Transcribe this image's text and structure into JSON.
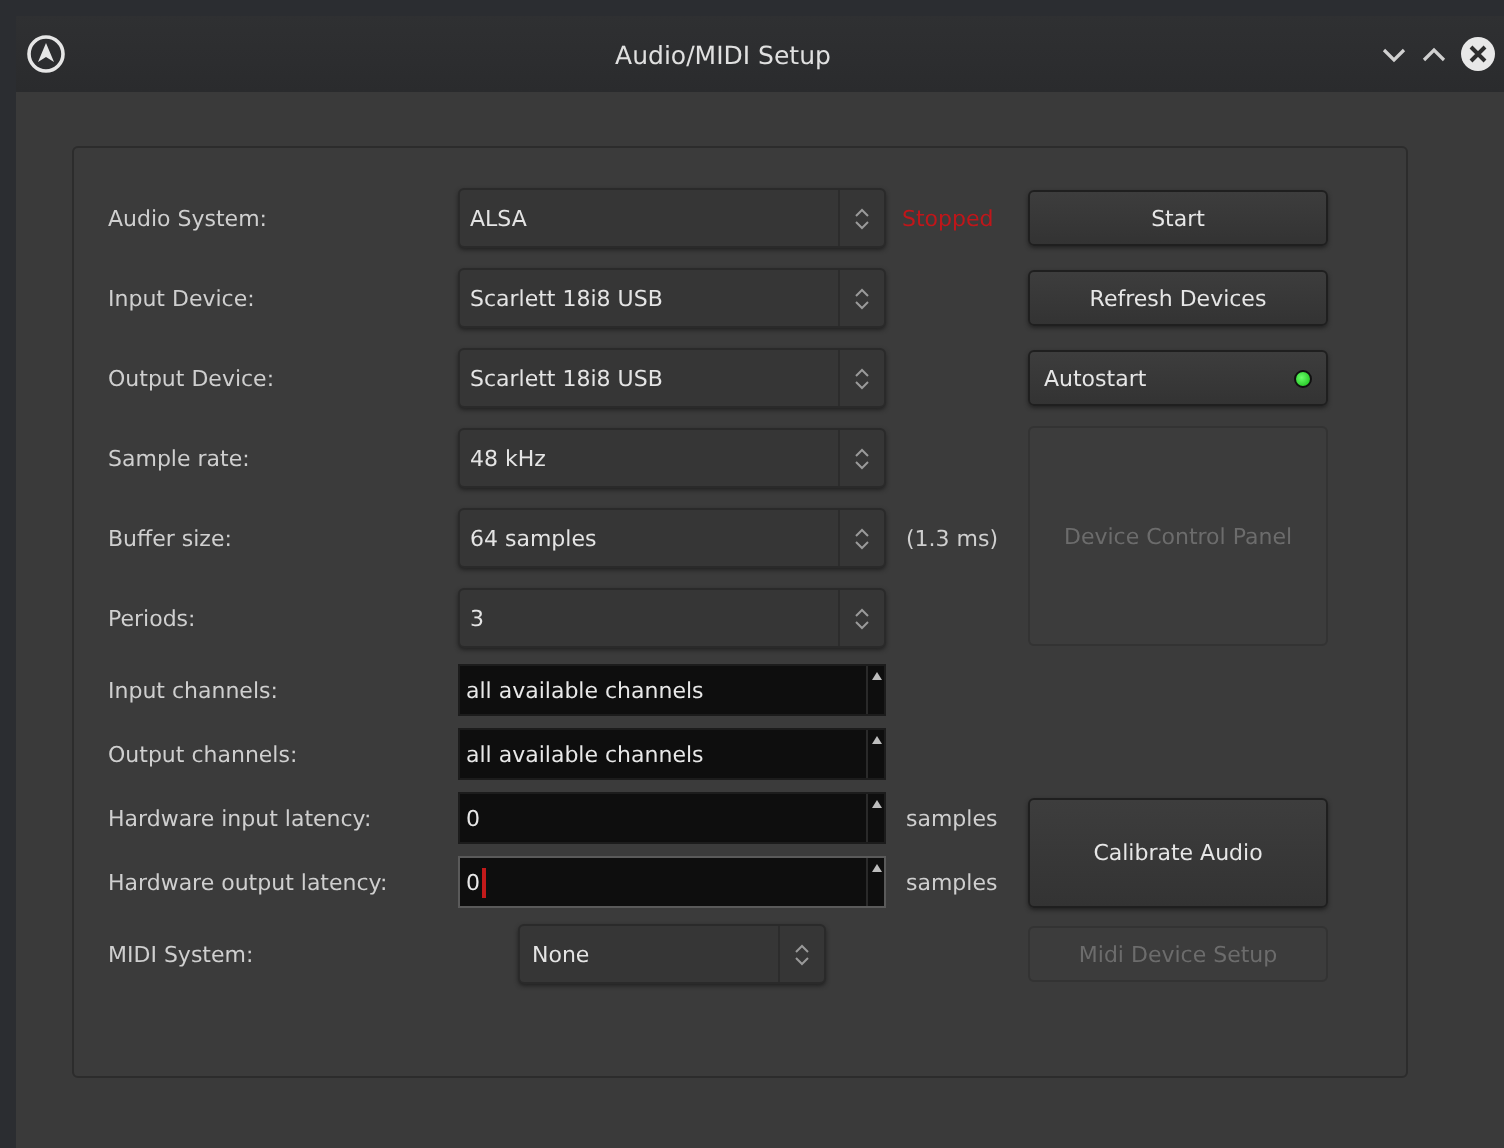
{
  "window": {
    "title": "Audio/MIDI Setup"
  },
  "rows": [
    {
      "kind": "combo",
      "label": "Audio System:",
      "value": "ALSA",
      "note": {
        "text": "Stopped",
        "kind": "status"
      }
    },
    {
      "kind": "combo",
      "label": "Input Device:",
      "value": "Scarlett 18i8 USB"
    },
    {
      "kind": "combo",
      "label": "Output Device:",
      "value": "Scarlett 18i8 USB"
    },
    {
      "kind": "combo",
      "label": "Sample rate:",
      "value": "48 kHz"
    },
    {
      "kind": "combo",
      "label": "Buffer size:",
      "value": "64 samples",
      "note": {
        "text": "(1.3 ms)",
        "kind": "plain"
      }
    },
    {
      "kind": "combo",
      "label": "Periods:",
      "value": "3"
    },
    {
      "kind": "spin",
      "label": "Input channels:",
      "value": "all available channels",
      "focused": false
    },
    {
      "kind": "spin",
      "label": "Output channels:",
      "value": "all available channels",
      "focused": false
    },
    {
      "kind": "spin",
      "label": "Hardware input latency:",
      "value": "0",
      "focused": false,
      "note": {
        "text": "samples",
        "kind": "plain"
      }
    },
    {
      "kind": "spin",
      "label": "Hardware output latency:",
      "value": "0",
      "focused": true,
      "note": {
        "text": "samples",
        "kind": "plain"
      }
    },
    {
      "kind": "combo",
      "label": "MIDI System:",
      "value": "None",
      "narrow": true
    }
  ],
  "buttons": [
    {
      "kind": "push",
      "label": "Start",
      "disabled": false
    },
    {
      "kind": "push",
      "label": "Refresh Devices",
      "disabled": false
    },
    {
      "kind": "toggle",
      "label": "Autostart",
      "disabled": false,
      "on": true
    },
    {
      "kind": "push",
      "label": "Device Control Panel",
      "disabled": true
    },
    {
      "kind": "push",
      "label": "Calibrate Audio",
      "disabled": false
    },
    {
      "kind": "push",
      "label": "Midi Device Setup",
      "disabled": true
    }
  ]
}
